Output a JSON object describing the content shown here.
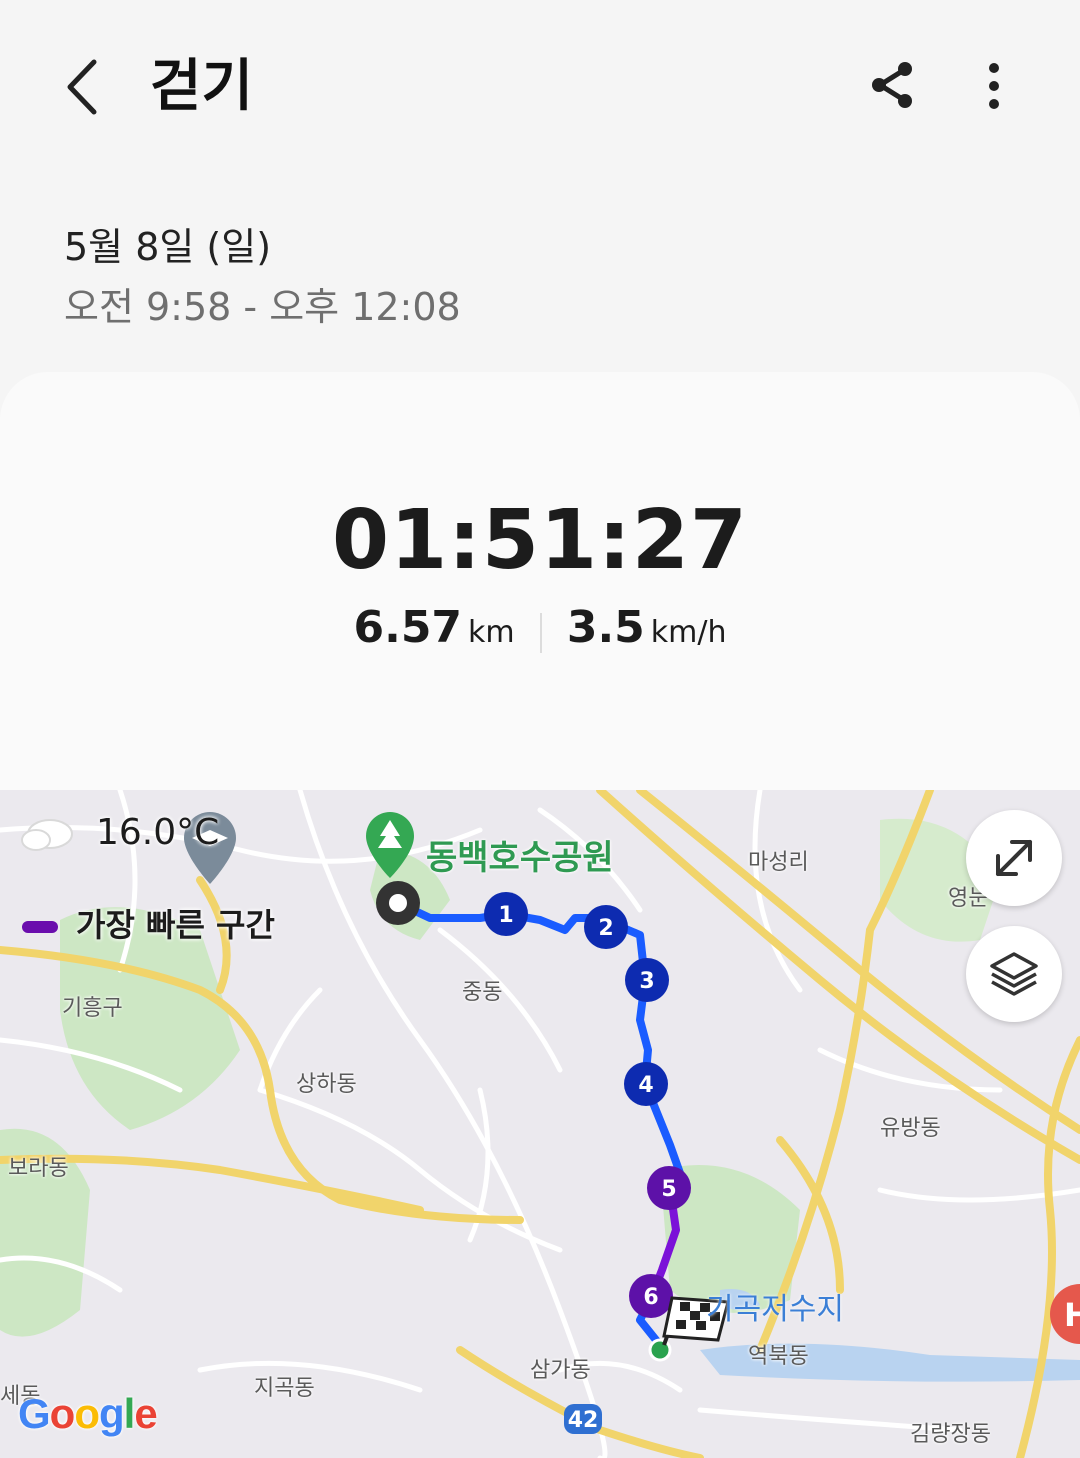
{
  "header": {
    "title": "걷기",
    "back_icon": "chevron-left-icon",
    "share_icon": "share-icon",
    "more_icon": "more-vertical-icon"
  },
  "session": {
    "date": "5월 8일 (일)",
    "time_range": "오전 9:58 - 오후 12:08"
  },
  "summary": {
    "duration": "01:51:27",
    "distance": "6.57",
    "distance_unit": "km",
    "speed": "3.5",
    "speed_unit": "km/h"
  },
  "map": {
    "weather": "16.0°C",
    "weather_icon": "cloud-icon",
    "legend_label": "가장 빠른 구간",
    "fastest_color": "#6a0dad",
    "route_color": "#1a5cff",
    "park_name": "동백호수공원",
    "reservoir_name": "기곡저수지",
    "places": [
      "마성리",
      "영눈",
      "기흥구",
      "중동",
      "상하동",
      "유방동",
      "보라동",
      "지곡동",
      "삼가동",
      "역북동",
      "세동",
      "김량장동"
    ],
    "road_number": "42",
    "splits": [
      "1",
      "2",
      "3",
      "4",
      "5",
      "6"
    ],
    "google_letters": [
      "G",
      "o",
      "o",
      "g",
      "l",
      "e"
    ],
    "expand_icon": "expand-icon",
    "layers_icon": "layers-icon"
  }
}
